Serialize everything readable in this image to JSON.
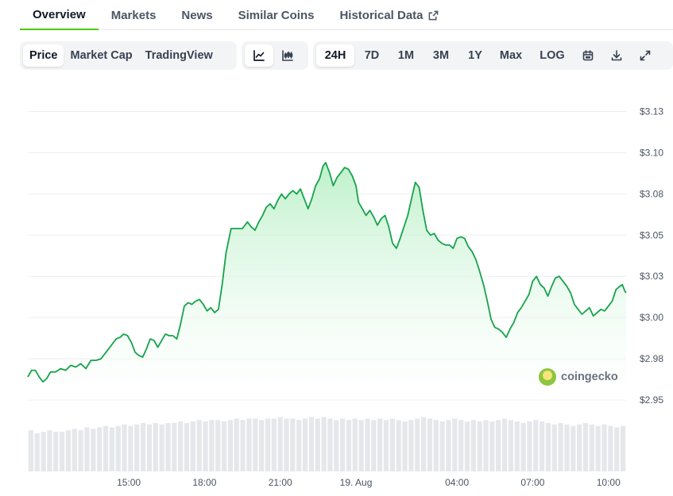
{
  "tabs": [
    {
      "label": "Overview",
      "active": true
    },
    {
      "label": "Markets"
    },
    {
      "label": "News"
    },
    {
      "label": "Similar Coins"
    },
    {
      "label": "Historical Data",
      "external": true
    }
  ],
  "toolbar": {
    "metrics": [
      "Price",
      "Market Cap",
      "TradingView"
    ],
    "active_metric": "Price",
    "chart_types": [
      {
        "icon": "line-chart-icon",
        "active": true
      },
      {
        "icon": "candlestick-chart-icon",
        "active": false
      }
    ],
    "ranges": [
      "24H",
      "7D",
      "1M",
      "3M",
      "1Y",
      "Max",
      "LOG"
    ],
    "active_range": "24H",
    "tools": [
      "calendar-icon",
      "download-icon",
      "fullscreen-icon"
    ]
  },
  "watermark": "coingecko",
  "colors": {
    "line": "#16a34a",
    "fill_top": "#bbf0c8",
    "volume": "#e5e7eb",
    "accent": "#4bcc00"
  },
  "chart_data": {
    "type": "area",
    "y_ticks": [
      2.95,
      2.975,
      3.0,
      3.025,
      3.05,
      3.075,
      3.1,
      3.125
    ],
    "y_tick_labels": [
      "$2.95",
      "$2.98",
      "$3.00",
      "$3.03",
      "$3.05",
      "$3.08",
      "$3.10",
      "$3.13"
    ],
    "ylim": [
      2.95,
      3.125
    ],
    "x_ticks": [
      {
        "label": "15:00",
        "h": 4
      },
      {
        "label": "18:00",
        "h": 7
      },
      {
        "label": "21:00",
        "h": 10
      },
      {
        "label": "19. Aug",
        "h": 13
      },
      {
        "label": "04:00",
        "h": 17
      },
      {
        "label": "07:00",
        "h": 20
      },
      {
        "label": "10:00",
        "h": 23
      }
    ],
    "xlim": [
      0,
      23.7
    ],
    "grid": true,
    "legend": "none",
    "price": [
      [
        0.0,
        2.964
      ],
      [
        0.15,
        2.968
      ],
      [
        0.3,
        2.968
      ],
      [
        0.45,
        2.964
      ],
      [
        0.6,
        2.961
      ],
      [
        0.75,
        2.963
      ],
      [
        0.9,
        2.967
      ],
      [
        1.1,
        2.967
      ],
      [
        1.3,
        2.969
      ],
      [
        1.5,
        2.968
      ],
      [
        1.7,
        2.971
      ],
      [
        1.9,
        2.97
      ],
      [
        2.1,
        2.972
      ],
      [
        2.3,
        2.969
      ],
      [
        2.5,
        2.974
      ],
      [
        2.7,
        2.974
      ],
      [
        2.9,
        2.975
      ],
      [
        3.1,
        2.979
      ],
      [
        3.3,
        2.983
      ],
      [
        3.5,
        2.987
      ],
      [
        3.65,
        2.988
      ],
      [
        3.8,
        2.99
      ],
      [
        3.95,
        2.989
      ],
      [
        4.1,
        2.985
      ],
      [
        4.25,
        2.979
      ],
      [
        4.4,
        2.977
      ],
      [
        4.55,
        2.976
      ],
      [
        4.7,
        2.981
      ],
      [
        4.85,
        2.987
      ],
      [
        5.0,
        2.986
      ],
      [
        5.15,
        2.982
      ],
      [
        5.3,
        2.986
      ],
      [
        5.45,
        2.99
      ],
      [
        5.6,
        2.989
      ],
      [
        5.75,
        2.989
      ],
      [
        5.9,
        2.987
      ],
      [
        6.05,
        2.996
      ],
      [
        6.2,
        3.007
      ],
      [
        6.35,
        3.009
      ],
      [
        6.5,
        3.008
      ],
      [
        6.65,
        3.01
      ],
      [
        6.8,
        3.011
      ],
      [
        6.95,
        3.008
      ],
      [
        7.1,
        3.004
      ],
      [
        7.25,
        3.006
      ],
      [
        7.4,
        3.003
      ],
      [
        7.55,
        3.005
      ],
      [
        7.7,
        3.02
      ],
      [
        7.85,
        3.039
      ],
      [
        8.05,
        3.054
      ],
      [
        8.3,
        3.054
      ],
      [
        8.5,
        3.054
      ],
      [
        8.7,
        3.058
      ],
      [
        8.85,
        3.055
      ],
      [
        9.0,
        3.053
      ],
      [
        9.15,
        3.058
      ],
      [
        9.3,
        3.062
      ],
      [
        9.45,
        3.067
      ],
      [
        9.6,
        3.069
      ],
      [
        9.75,
        3.066
      ],
      [
        9.9,
        3.071
      ],
      [
        10.05,
        3.075
      ],
      [
        10.2,
        3.072
      ],
      [
        10.35,
        3.075
      ],
      [
        10.5,
        3.077
      ],
      [
        10.65,
        3.075
      ],
      [
        10.8,
        3.078
      ],
      [
        10.95,
        3.072
      ],
      [
        11.1,
        3.066
      ],
      [
        11.25,
        3.072
      ],
      [
        11.4,
        3.08
      ],
      [
        11.55,
        3.084
      ],
      [
        11.7,
        3.092
      ],
      [
        11.8,
        3.094
      ],
      [
        11.95,
        3.088
      ],
      [
        12.1,
        3.08
      ],
      [
        12.25,
        3.085
      ],
      [
        12.4,
        3.088
      ],
      [
        12.55,
        3.091
      ],
      [
        12.7,
        3.09
      ],
      [
        12.85,
        3.086
      ],
      [
        13.0,
        3.08
      ],
      [
        13.1,
        3.07
      ],
      [
        13.25,
        3.066
      ],
      [
        13.4,
        3.062
      ],
      [
        13.55,
        3.065
      ],
      [
        13.7,
        3.061
      ],
      [
        13.85,
        3.056
      ],
      [
        14.0,
        3.06
      ],
      [
        14.15,
        3.062
      ],
      [
        14.3,
        3.055
      ],
      [
        14.45,
        3.045
      ],
      [
        14.6,
        3.042
      ],
      [
        14.75,
        3.048
      ],
      [
        14.9,
        3.055
      ],
      [
        15.05,
        3.062
      ],
      [
        15.2,
        3.072
      ],
      [
        15.35,
        3.082
      ],
      [
        15.5,
        3.079
      ],
      [
        15.65,
        3.065
      ],
      [
        15.8,
        3.053
      ],
      [
        15.95,
        3.05
      ],
      [
        16.1,
        3.051
      ],
      [
        16.25,
        3.047
      ],
      [
        16.4,
        3.045
      ],
      [
        16.55,
        3.044
      ],
      [
        16.7,
        3.044
      ],
      [
        16.85,
        3.042
      ],
      [
        17.0,
        3.048
      ],
      [
        17.15,
        3.049
      ],
      [
        17.3,
        3.048
      ],
      [
        17.45,
        3.043
      ],
      [
        17.6,
        3.04
      ],
      [
        17.75,
        3.035
      ],
      [
        17.9,
        3.028
      ],
      [
        18.05,
        3.02
      ],
      [
        18.2,
        3.01
      ],
      [
        18.35,
        2.999
      ],
      [
        18.5,
        2.994
      ],
      [
        18.65,
        2.993
      ],
      [
        18.8,
        2.991
      ],
      [
        18.95,
        2.988
      ],
      [
        19.1,
        2.993
      ],
      [
        19.25,
        2.997
      ],
      [
        19.4,
        3.003
      ],
      [
        19.55,
        3.006
      ],
      [
        19.7,
        3.01
      ],
      [
        19.85,
        3.014
      ],
      [
        20.0,
        3.022
      ],
      [
        20.15,
        3.025
      ],
      [
        20.3,
        3.02
      ],
      [
        20.45,
        3.018
      ],
      [
        20.6,
        3.013
      ],
      [
        20.75,
        3.019
      ],
      [
        20.9,
        3.024
      ],
      [
        21.05,
        3.025
      ],
      [
        21.2,
        3.022
      ],
      [
        21.35,
        3.019
      ],
      [
        21.5,
        3.015
      ],
      [
        21.65,
        3.008
      ],
      [
        21.8,
        3.005
      ],
      [
        21.95,
        3.002
      ],
      [
        22.1,
        3.004
      ],
      [
        22.25,
        3.006
      ],
      [
        22.4,
        3.001
      ],
      [
        22.55,
        3.003
      ],
      [
        22.7,
        3.005
      ],
      [
        22.85,
        3.004
      ],
      [
        23.0,
        3.007
      ],
      [
        23.15,
        3.01
      ],
      [
        23.3,
        3.017
      ],
      [
        23.45,
        3.019
      ],
      [
        23.55,
        3.02
      ],
      [
        23.65,
        3.016
      ],
      [
        23.7,
        3.015
      ]
    ],
    "volume": [
      28,
      26,
      27,
      28,
      27,
      27,
      28,
      29,
      28,
      30,
      29,
      30,
      31,
      30,
      31,
      32,
      31,
      32,
      33,
      32,
      33,
      32,
      33,
      33,
      34,
      33,
      34,
      35,
      34,
      35,
      35,
      34,
      35,
      36,
      35,
      36,
      36,
      35,
      36,
      36,
      37,
      36,
      36,
      35,
      36,
      37,
      36,
      37,
      36,
      35,
      36,
      35,
      36,
      35,
      36,
      35,
      36,
      35,
      36,
      35,
      34,
      35,
      36,
      37,
      36,
      35,
      34,
      35,
      36,
      35,
      34,
      35,
      34,
      35,
      34,
      35,
      36,
      35,
      34,
      33,
      34,
      35,
      34,
      33,
      32,
      33,
      32,
      31,
      32,
      33,
      32,
      31,
      32,
      31,
      30,
      31
    ]
  }
}
